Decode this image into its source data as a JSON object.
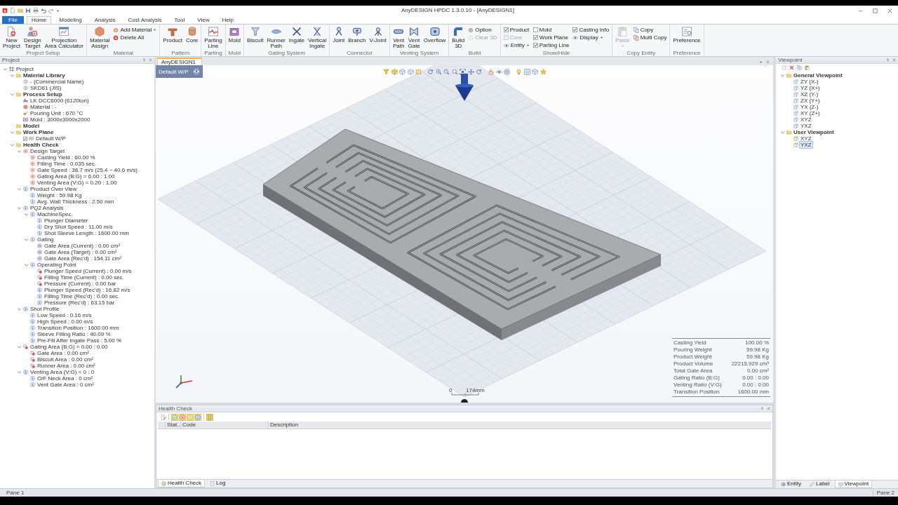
{
  "window": {
    "title": "AnyDESIGN HPDC 1.3.0.10 - [AnyDESIGN1]"
  },
  "ribbon": {
    "tabs": [
      {
        "label": "File",
        "kind": "file",
        "selected": false
      },
      {
        "label": "Home",
        "kind": "tab",
        "selected": true
      },
      {
        "label": "Modeling",
        "kind": "tab",
        "selected": false
      },
      {
        "label": "Analysis",
        "kind": "tab",
        "selected": false
      },
      {
        "label": "Cost Analysis",
        "kind": "tab",
        "selected": false
      },
      {
        "label": "Tool",
        "kind": "tab",
        "selected": false
      },
      {
        "label": "View",
        "kind": "tab",
        "selected": false
      },
      {
        "label": "Help",
        "kind": "tab",
        "selected": false
      }
    ],
    "groups": [
      {
        "label": "Project Setup",
        "items": [
          {
            "label": "New\nProject",
            "kind": "large"
          },
          {
            "label": "Design\nTarget",
            "kind": "large"
          },
          {
            "label": "Projection\nArea Calculator",
            "kind": "large"
          }
        ]
      },
      {
        "label": "Material",
        "items": [
          {
            "label": "Material\nAssign",
            "kind": "large"
          },
          {
            "label": "Add Material",
            "kind": "menu"
          },
          {
            "label": "Delete All",
            "kind": "small"
          }
        ]
      },
      {
        "label": "Pattern",
        "items": [
          {
            "label": "Product",
            "kind": "large"
          },
          {
            "label": "Core",
            "kind": "large"
          }
        ]
      },
      {
        "label": "Parting",
        "items": [
          {
            "label": "Parting\nLine",
            "kind": "large"
          }
        ]
      },
      {
        "label": "Mold",
        "items": [
          {
            "label": "Mold",
            "kind": "large"
          }
        ]
      },
      {
        "label": "Gating System",
        "items": [
          {
            "label": "Biscuit",
            "kind": "large"
          },
          {
            "label": "Runner\nPath",
            "kind": "large"
          },
          {
            "label": "Ingate",
            "kind": "large"
          },
          {
            "label": "Vertical\nIngate",
            "kind": "large"
          }
        ]
      },
      {
        "label": "Connector",
        "items": [
          {
            "label": "Joint",
            "kind": "large"
          },
          {
            "label": "Branch",
            "kind": "large"
          },
          {
            "label": "V-Joint",
            "kind": "large"
          }
        ]
      },
      {
        "label": "Venting System",
        "items": [
          {
            "label": "Vent\nPath",
            "kind": "large"
          },
          {
            "label": "Vent\nGate",
            "kind": "large"
          },
          {
            "label": "Overflow",
            "kind": "large"
          }
        ]
      },
      {
        "label": "Build",
        "items": [
          {
            "label": "Build\n3D",
            "kind": "large",
            "disabled": false
          },
          {
            "label": "Option",
            "kind": "small",
            "disabled": false
          },
          {
            "label": "Clear 3D",
            "kind": "small",
            "disabled": true
          }
        ]
      },
      {
        "label": "Show/Hide",
        "items": [
          {
            "label": "Product",
            "kind": "check",
            "checked": true,
            "disabled": false
          },
          {
            "label": "Core",
            "kind": "check",
            "checked": false,
            "disabled": true
          },
          {
            "label": "Entity",
            "kind": "menu",
            "disabled": false
          },
          {
            "label": "Mold",
            "kind": "check",
            "checked": false,
            "disabled": false
          },
          {
            "label": "Work Plane",
            "kind": "check",
            "checked": true,
            "disabled": false
          },
          {
            "label": "Parting Line",
            "kind": "check",
            "checked": true,
            "disabled": false
          },
          {
            "label": "Casting Info",
            "kind": "check",
            "checked": true,
            "disabled": false
          },
          {
            "label": "Display",
            "kind": "menu",
            "disabled": false
          }
        ]
      },
      {
        "label": "Copy Entity",
        "items": [
          {
            "label": "Paste",
            "kind": "large-menu",
            "disabled": true
          },
          {
            "label": "Copy",
            "kind": "small",
            "disabled": false
          },
          {
            "label": "Multi Copy",
            "kind": "small",
            "disabled": false
          }
        ]
      },
      {
        "label": "Preference",
        "items": [
          {
            "label": "Preference",
            "kind": "large"
          }
        ]
      }
    ]
  },
  "project_panel": {
    "title": "Project",
    "tree": [
      {
        "label": "Project",
        "kind": "project",
        "expanded": true,
        "children": [
          {
            "label": "Material Library",
            "kind": "folder",
            "expanded": true,
            "children": [
              {
                "label": "- (Commercial Name)",
                "kind": "gear"
              },
              {
                "label": "SKD61 (JIS)",
                "kind": "gear"
              }
            ]
          },
          {
            "label": "Process Setup",
            "kind": "folder",
            "expanded": true,
            "children": [
              {
                "label": "LK DCC6000 (6120ton)",
                "kind": "machine"
              },
              {
                "label": "Material : -",
                "kind": "material"
              },
              {
                "label": "Pouring Unit : 670 °C",
                "kind": "ladle"
              },
              {
                "label": "Mold : 3000x3000x2000",
                "kind": "mold"
              }
            ]
          },
          {
            "label": "Model",
            "kind": "folder"
          },
          {
            "label": "Work Plane",
            "kind": "folder",
            "expanded": true,
            "children": [
              {
                "label": "Default W/P",
                "kind": "plane",
                "checked": true
              }
            ]
          },
          {
            "label": "Health Check",
            "kind": "folder",
            "expanded": true,
            "children": [
              {
                "label": "Design Target",
                "kind": "target",
                "expanded": true,
                "children": [
                  {
                    "label": "Casting Yield : 60.00 %",
                    "kind": "target"
                  },
                  {
                    "label": "Filling Time : 0.035 sec.",
                    "kind": "target"
                  },
                  {
                    "label": "Gate Speed : 38.7 m/s (25.4 ~ 40.6 m/s)",
                    "kind": "target"
                  },
                  {
                    "label": "Gating Area (B:G) = 6.00 : 1.00",
                    "kind": "target"
                  },
                  {
                    "label": "Venting Area (V:G) = 0.20 : 1.00",
                    "kind": "target"
                  }
                ]
              },
              {
                "label": "Product Over View",
                "kind": "info",
                "expanded": true,
                "children": [
                  {
                    "label": "Weight : 59.98 Kg",
                    "kind": "info"
                  },
                  {
                    "label": "Avg. Wall Thickness : 2.50 mm",
                    "kind": "info"
                  }
                ]
              },
              {
                "label": "PQ2 Analysis",
                "kind": "info",
                "expanded": true,
                "children": [
                  {
                    "label": "MachineSpec.",
                    "kind": "info",
                    "expanded": true,
                    "children": [
                      {
                        "label": "Plunger Diameter",
                        "kind": "info"
                      },
                      {
                        "label": "Dry Shot Speed : 11.00 m/s",
                        "kind": "info"
                      },
                      {
                        "label": "Shot Sleeve Length : 1600.00 mm",
                        "kind": "info"
                      }
                    ]
                  },
                  {
                    "label": "Gating",
                    "kind": "info",
                    "expanded": true,
                    "children": [
                      {
                        "label": "Gate Area (Current) : 0.00 cm²",
                        "kind": "gauge"
                      },
                      {
                        "label": "Gate Area (Target) : 0.00 cm²",
                        "kind": "gauge"
                      },
                      {
                        "label": "Gate Area (Rec'd) : 154.11 cm²",
                        "kind": "gauge"
                      }
                    ]
                  },
                  {
                    "label": "Operating Point",
                    "kind": "info",
                    "expanded": true,
                    "children": [
                      {
                        "label": "Plunger Speed (Current) : 0.00 m/s",
                        "kind": "alert"
                      },
                      {
                        "label": "Filling Time (Current) : 0.00 sec.",
                        "kind": "alert"
                      },
                      {
                        "label": "Pressure (Current) : 0.00 bar",
                        "kind": "alert"
                      },
                      {
                        "label": "Plunger Speed (Rec'd) : 16.82 m/s",
                        "kind": "info"
                      },
                      {
                        "label": "Filling Time (Rec'd) : 0.00 sec.",
                        "kind": "info"
                      },
                      {
                        "label": "Pressure (Rec'd) : 63.15 bar",
                        "kind": "info"
                      }
                    ]
                  }
                ]
              },
              {
                "label": "Shot Profile",
                "kind": "info",
                "expanded": true,
                "children": [
                  {
                    "label": "Low Speed : 0.16 m/s",
                    "kind": "info"
                  },
                  {
                    "label": "High Speed : 0.00 m/s",
                    "kind": "info"
                  },
                  {
                    "label": "Transition Position : 1600.00 mm",
                    "kind": "info"
                  },
                  {
                    "label": "Sleeve Filling Ratio : 40.09 %",
                    "kind": "info"
                  },
                  {
                    "label": "Pre-Fill After Ingate Pass : 5.00 %",
                    "kind": "info"
                  }
                ]
              },
              {
                "label": "Gating Area (B:G) = 0.00 : 0.00",
                "kind": "alert",
                "expanded": true,
                "children": [
                  {
                    "label": "Gate Area : 0.00 cm²",
                    "kind": "alert"
                  },
                  {
                    "label": "Biscuit Area : 0.00 cm²",
                    "kind": "alert"
                  },
                  {
                    "label": "Runner Area : 0.00 cm²",
                    "kind": "alert"
                  }
                ]
              },
              {
                "label": "Venting Area (V:G) = 0 : 0",
                "kind": "info",
                "expanded": true,
                "children": [
                  {
                    "label": "O/F Neck Area : 0 cm²",
                    "kind": "info"
                  },
                  {
                    "label": "Vent Gate Area : 0 cm²",
                    "kind": "info"
                  }
                ]
              }
            ]
          }
        ]
      }
    ]
  },
  "document_tabs": [
    {
      "label": "AnyDESIGN1",
      "selected": true
    }
  ],
  "viewport": {
    "work_plane_tag": "Default W/P",
    "scale_labels": [
      "0",
      "174mm"
    ],
    "casting_info": [
      {
        "label": "Casting Yield",
        "value": "100.00 %"
      },
      {
        "label": "Pouring Weight",
        "value": "59.98 Kg"
      },
      {
        "label": "Product Weight",
        "value": "59.98 Kg"
      },
      {
        "label": "Product Volume",
        "value": "22215.929 cm³"
      },
      {
        "label": "Total Gate Area",
        "value": "0.00 cm²"
      },
      {
        "label": "Gating Ratio (B:G)",
        "value": "0.00 : 0.00"
      },
      {
        "label": "Venting Ratio (V:G)",
        "value": "0.00 : 0.00"
      },
      {
        "label": "Transition Position",
        "value": "1600.00 mm"
      }
    ]
  },
  "health_check": {
    "title": "Health Check",
    "filters": [
      {
        "kind": "success",
        "on": true
      },
      {
        "kind": "error",
        "on": true
      },
      {
        "kind": "warning",
        "on": true
      },
      {
        "kind": "info",
        "on": true
      }
    ],
    "columns": [
      "Stat...",
      "Code",
      "Description"
    ],
    "tabs": [
      {
        "label": "Health Check",
        "selected": true
      },
      {
        "label": "Log",
        "selected": false
      }
    ]
  },
  "viewpoint_panel": {
    "title": "Viewpoint",
    "tree": [
      {
        "label": "General Viewpoint",
        "kind": "folder",
        "expanded": true,
        "selected": false,
        "children": [
          {
            "label": "ZY (X-)",
            "kind": "view",
            "selected": false
          },
          {
            "label": "YZ (X+)",
            "kind": "view",
            "selected": false
          },
          {
            "label": "XZ (Y-)",
            "kind": "view",
            "selected": false
          },
          {
            "label": "ZX (Y+)",
            "kind": "view",
            "selected": false
          },
          {
            "label": "YX (Z-)",
            "kind": "view",
            "selected": false
          },
          {
            "label": "XY (Z+)",
            "kind": "view",
            "selected": false
          },
          {
            "label": "XYZ",
            "kind": "view",
            "selected": false
          },
          {
            "label": "YXZ",
            "kind": "view",
            "selected": false
          }
        ]
      },
      {
        "label": "User Viewpoint",
        "kind": "folder",
        "expanded": true,
        "selected": false,
        "children": [
          {
            "label": "XYZ",
            "kind": "user-view",
            "selected": false
          },
          {
            "label": "YXZ",
            "kind": "user-view",
            "selected": true
          }
        ]
      }
    ],
    "tabs": [
      {
        "label": "Entity",
        "selected": false
      },
      {
        "label": "Label",
        "selected": false
      },
      {
        "label": "Viewpoint",
        "selected": true
      }
    ]
  },
  "status_bar": {
    "panes": [
      "Pane 1",
      "Pane 2"
    ]
  }
}
